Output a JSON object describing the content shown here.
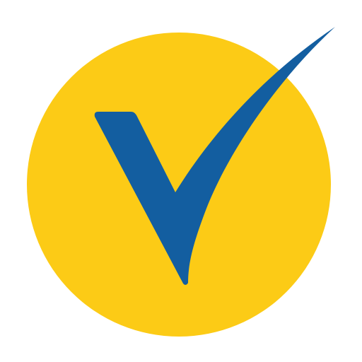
{
  "logo": {
    "name": "checkmark-circle-logo",
    "colors": {
      "background": "#ffffff",
      "circle": "#fccb16",
      "checkmark": "#135ea0"
    }
  }
}
